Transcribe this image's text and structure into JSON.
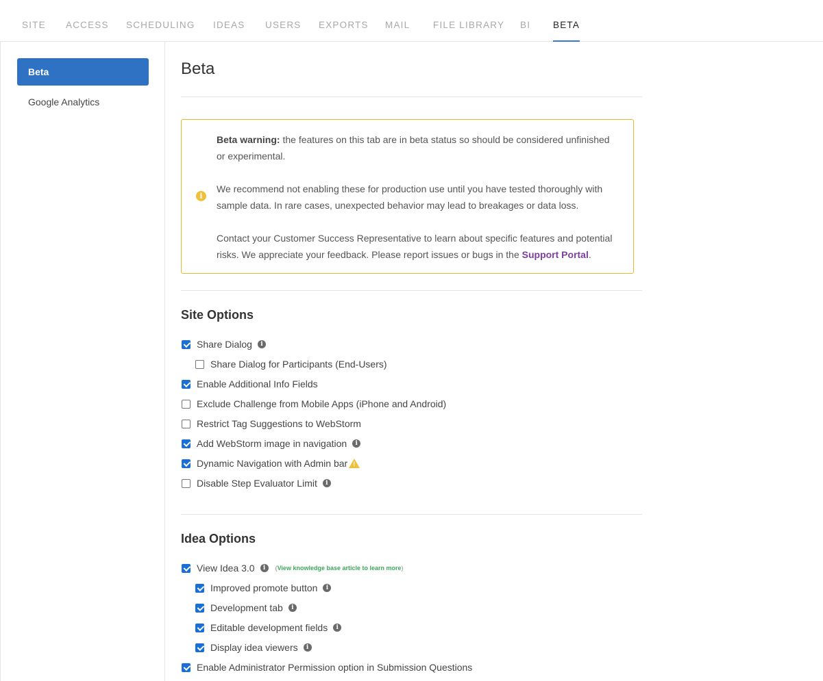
{
  "nav": {
    "tabs": [
      {
        "label": "SITE"
      },
      {
        "label": "ACCESS"
      },
      {
        "label": "SCHEDULING"
      },
      {
        "label": "IDEAS"
      },
      {
        "label": "USERS"
      },
      {
        "label": "EXPORTS"
      },
      {
        "label": "MAIL"
      },
      {
        "label": "FILE LIBRARY"
      },
      {
        "label": "BI"
      },
      {
        "label": "BETA"
      }
    ],
    "active": "BETA"
  },
  "sidebar": {
    "items": [
      {
        "label": "Beta",
        "active": true
      },
      {
        "label": "Google Analytics",
        "active": false
      }
    ]
  },
  "page": {
    "title": "Beta"
  },
  "warning": {
    "bold_lead": "Beta warning:",
    "p1_rest": " the features on this tab are in beta status so should be considered unfinished or experimental.",
    "p2": "We recommend not enabling these for production use until you have tested thoroughly with sample data. In rare cases, unexpected behavior may lead to breakages or data loss.",
    "p3_pre": "Contact your Customer Success Representative to learn about specific features and potential risks. We appreciate your feedback. Please report issues or bugs in the ",
    "p3_link": "Support Portal",
    "p3_post": ".",
    "accent_color": "#e8b730"
  },
  "site_options": {
    "title": "Site Options",
    "items": [
      {
        "label": "Share Dialog",
        "checked": true,
        "info": true
      },
      {
        "label": "Share Dialog for Participants (End-Users)",
        "checked": false,
        "info": false
      },
      {
        "label": "Enable Additional Info Fields",
        "checked": true,
        "info": false
      },
      {
        "label": "Exclude Challenge from Mobile Apps (iPhone and Android)",
        "checked": false,
        "info": false
      },
      {
        "label": "Restrict Tag Suggestions to WebStorm",
        "checked": false,
        "info": false
      },
      {
        "label": "Add WebStorm image in navigation",
        "checked": true,
        "info": true
      },
      {
        "label": "Dynamic Navigation with Admin bar",
        "checked": true,
        "info": false,
        "warning_icon": true
      },
      {
        "label": "Disable Step Evaluator Limit",
        "checked": false,
        "info": true
      }
    ]
  },
  "idea_options": {
    "title": "Idea Options",
    "items": [
      {
        "label": "View Idea 3.0",
        "checked": true,
        "info": true
      },
      {
        "label": "Improved promote button",
        "checked": true,
        "info": true
      },
      {
        "label": "Development tab",
        "checked": true,
        "info": true
      },
      {
        "label": "Editable development fields",
        "checked": true,
        "info": true
      },
      {
        "label": "Display idea viewers",
        "checked": true,
        "info": true
      },
      {
        "label": "Enable Administrator Permission option in Submission Questions",
        "checked": true,
        "info": false
      }
    ],
    "kb_link": {
      "open": "(",
      "text": "View knowledge base article to learn more",
      "close": ")"
    }
  },
  "colors": {
    "primary": "#2f72c3",
    "checkbox": "#1a6fd6",
    "link_purple": "#7b3fa0",
    "link_green": "#3caa5a"
  }
}
